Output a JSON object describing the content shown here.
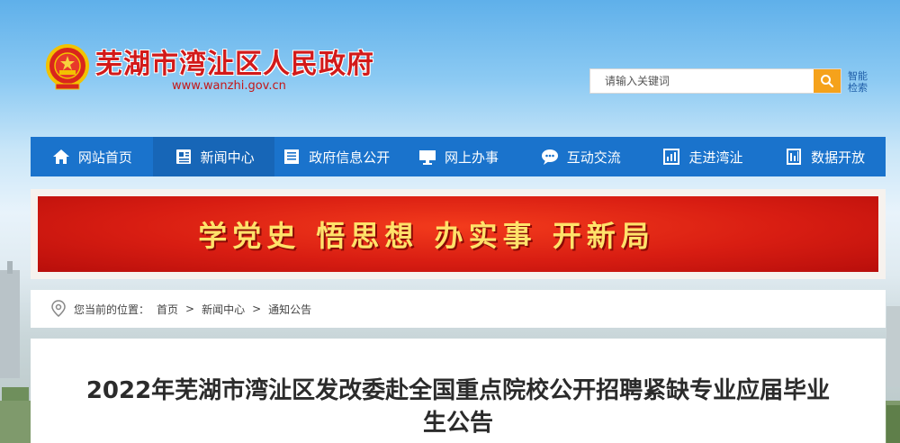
{
  "header": {
    "site_title": "芜湖市湾沚区人民政府",
    "site_url": "www.wanzhi.gov.cn",
    "search_placeholder": "请输入关键词",
    "smart_search_label": "智能检索"
  },
  "nav": {
    "items": [
      {
        "label": "网站首页",
        "icon": "home-icon"
      },
      {
        "label": "新闻中心",
        "icon": "news-icon"
      },
      {
        "label": "政府信息公开",
        "icon": "document-icon"
      },
      {
        "label": "网上办事",
        "icon": "monitor-icon"
      },
      {
        "label": "互动交流",
        "icon": "chat-icon"
      },
      {
        "label": "走进湾沚",
        "icon": "building-icon"
      },
      {
        "label": "数据开放",
        "icon": "data-icon"
      }
    ],
    "active_index": 1
  },
  "banner": {
    "text": "学党史 悟思想 办实事 开新局"
  },
  "breadcrumb": {
    "prefix": "您当前的位置：",
    "items": [
      "首页",
      "新闻中心",
      "通知公告"
    ],
    "separator": ">"
  },
  "article": {
    "title": "2022年芜湖市湾沚区发改委赴全国重点院校公开招聘紧缺专业应届毕业生公告"
  },
  "colors": {
    "nav_bg": "#1a73cc",
    "title_red": "#d21a1a",
    "search_button": "#f5a21b",
    "banner_red": "#d81d12",
    "banner_text": "#ffe26a"
  }
}
